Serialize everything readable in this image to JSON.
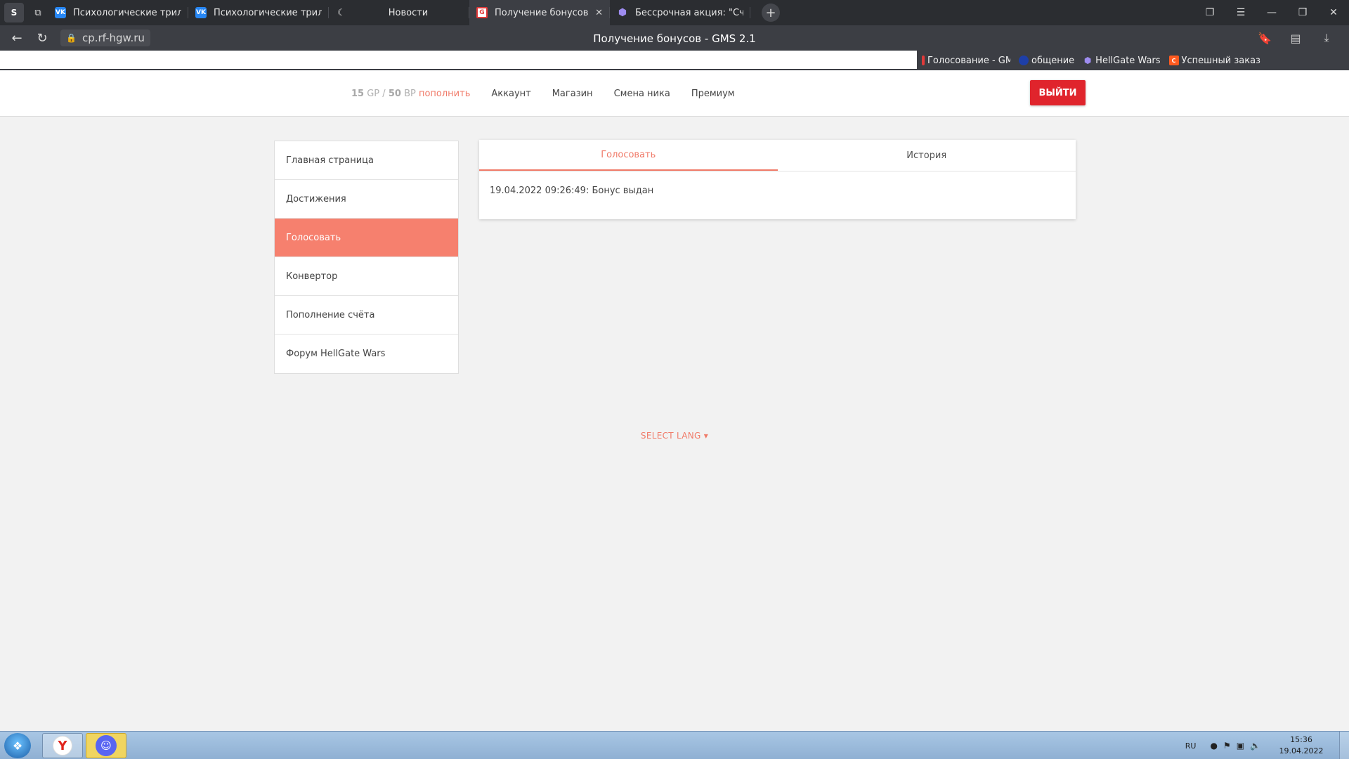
{
  "browser": {
    "profile_label": "S",
    "tabs": [
      {
        "title": "Психологические триллер",
        "icon": "vk-icon"
      },
      {
        "title": "Психологические триллер",
        "icon": "vk-icon"
      },
      {
        "title": "Новости",
        "icon": "moon-icon"
      },
      {
        "title": "Получение бонусов - G",
        "icon": "gms-icon",
        "active": true
      },
      {
        "title": "Бессрочная акция: \"Счас",
        "icon": "hex-icon"
      }
    ],
    "url": "cp.rf-hgw.ru",
    "page_title": "Получение бонусов - GMS 2.1",
    "bookmarks": [
      {
        "label": "Голосование - GM"
      },
      {
        "label": "общение"
      },
      {
        "label": "HellGate Wars"
      },
      {
        "label": "Успешный заказ"
      }
    ]
  },
  "header": {
    "gp_amount": "15",
    "gp_unit": "GP",
    "separator": "/",
    "bp_amount": "50",
    "bp_unit": "BP",
    "topup_label": "пополнить",
    "nav": [
      "Аккаунт",
      "Магазин",
      "Смена ника",
      "Премиум"
    ],
    "logout_label": "ВЫЙТИ"
  },
  "sidebar": {
    "items": [
      {
        "label": "Главная страница"
      },
      {
        "label": "Достижения"
      },
      {
        "label": "Голосовать",
        "active": true
      },
      {
        "label": "Конвертор"
      },
      {
        "label": "Пополнение счёта"
      },
      {
        "label": "Форум HellGate Wars"
      }
    ]
  },
  "main": {
    "tabs": [
      {
        "label": "Голосовать",
        "active": true
      },
      {
        "label": "История"
      }
    ],
    "history_entry": "19.04.2022 09:26:49: Бонус выдан"
  },
  "footer": {
    "select_lang": "SELECT LANG ▾"
  },
  "taskbar": {
    "lang": "RU",
    "time": "15:36",
    "date": "19.04.2022"
  },
  "colors": {
    "accent": "#f6806e",
    "logout": "#e0242c",
    "browser_dark": "#2b2d31"
  }
}
